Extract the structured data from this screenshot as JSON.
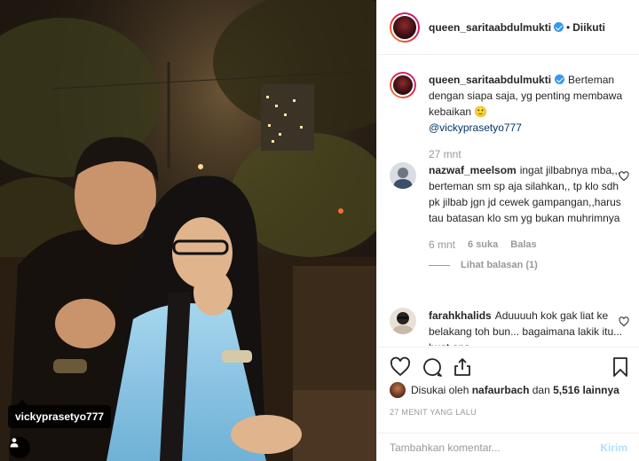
{
  "post": {
    "author": "queen_saritaabdulmukti",
    "follow_status": "Diikuti",
    "separator": "•",
    "photo_tag": "vickyprasetyo777"
  },
  "caption": {
    "user": "queen_saritaabdulmukti",
    "text": "Berteman dengan siapa saja, yg penting membawa kebaikan 🙂",
    "mention": "@vickyprasetyo777",
    "time": "27 mnt"
  },
  "comments": [
    {
      "user": "nazwaf_meelsom",
      "text": "ingat jilbabnya mba,,, berteman sm sp aja silahkan,, tp klo sdh pk jilbab jgn jd cewek gampangan,,harus tau batasan klo sm yg bukan muhrimnya",
      "time": "6 mnt",
      "likes": "6 suka",
      "reply": "Balas",
      "view_replies": "Lihat balasan (1)"
    },
    {
      "user": "farahkhalids",
      "text": "Aduuuuh kok gak liat ke belakang toh bun... bagaimana lakik itu... buat apa"
    }
  ],
  "likes": {
    "prefix": "Disukai oleh",
    "first_liker": "nafaurbach",
    "conjunction": "dan",
    "others": "5,516 lainnya"
  },
  "timestamp": "27 MENIT YANG LALU",
  "add_comment": {
    "placeholder": "Tambahkan komentar...",
    "submit_label": "Kirim"
  },
  "icons": {
    "like": "heart-icon",
    "comment": "comment-bubble-icon",
    "share": "share-icon",
    "save": "bookmark-icon",
    "tag": "person-tag-icon",
    "verified": "verified-badge-icon"
  },
  "colors": {
    "verified": "#3897f0",
    "submit_disabled": "#b2dffc",
    "muted_text": "#999999"
  }
}
